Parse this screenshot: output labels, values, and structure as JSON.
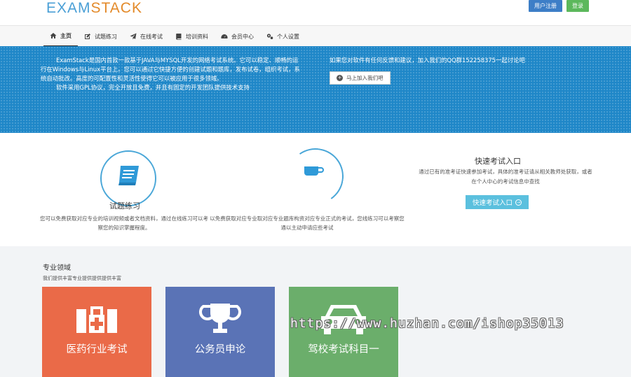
{
  "header": {
    "logo_exam": "EXAM",
    "logo_stack": "STACK",
    "register_label": "用户注册",
    "login_label": "登录"
  },
  "nav": {
    "items": [
      {
        "label": "主页",
        "icon": "home-icon",
        "active": true
      },
      {
        "label": "试题练习",
        "icon": "edit-icon"
      },
      {
        "label": "在线考试",
        "icon": "send-icon"
      },
      {
        "label": "培训资料",
        "icon": "book-icon"
      },
      {
        "label": "会员中心",
        "icon": "dashboard-icon"
      },
      {
        "label": "个人设置",
        "icon": "gear-icon"
      }
    ]
  },
  "banner": {
    "intro_p1": "ExamStack是国内首款一款基于JAVA与MYSQL开发的网络考试系统。它可以稳定、顺畅的运行在Windows与Linux平台上。您可以通过它快捷方便的创建试题和题库，发布试卷，组织考试，系统自动批改。高度的可配置性和灵活性使得它可以被应用于很多领域。",
    "intro_p2": "软件采用GPL协议，完全开放且免费，并且有固定的开发团队提供技术支持",
    "feedback": "如果您对软件有任何反馈和建议，加入我们的QQ群152258375一起讨论吧",
    "join_label": "马上加入我们吧"
  },
  "features": {
    "practice_title": "试题练习",
    "practice_desc": "您可以免费获取对应专业的培训视频或者文档资料，通过在线练习可以考察您的知识掌握程度。",
    "exam_desc": "以免费获取对应专业取对应专业题库构资对应专业正式的考试，您线练习可以考察您通以主动申请应些考试",
    "quick_title": "快速考试入口",
    "quick_desc": "通过已有的准考证快速参加考试，具体的准考证请从相关教师处获取，或者在个人中心的考试信息中查找",
    "quick_btn": "快速考试入口"
  },
  "domains": {
    "title": "专业领域",
    "subtitle": "我们提供丰富专业提供提供提供丰富",
    "cards": [
      {
        "label": "医药行业考试",
        "icon": "medical-icon",
        "color": "#ea6a48"
      },
      {
        "label": "公务员申论",
        "icon": "trophy-icon",
        "color": "#5a73b6"
      },
      {
        "label": "驾校考试科目一",
        "icon": "car-icon",
        "color": "#6bae6b"
      }
    ]
  },
  "watermark": "https://www.huzhan.com/ishop35013"
}
